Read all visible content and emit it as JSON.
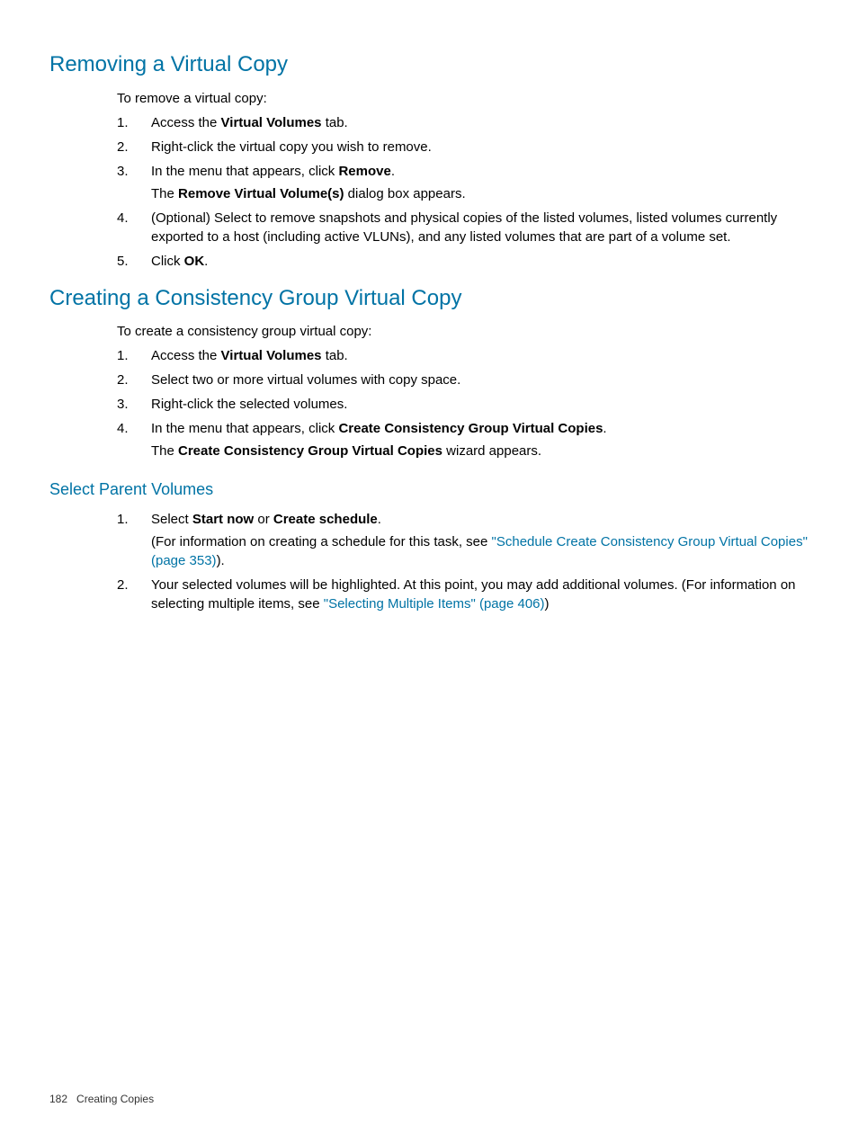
{
  "section1": {
    "title": "Removing a Virtual Copy",
    "intro": "To remove a virtual copy:",
    "items": {
      "i1_pre": "Access the ",
      "i1_bold": "Virtual Volumes",
      "i1_post": " tab.",
      "i2": "Right-click the virtual copy you wish to remove.",
      "i3_pre": "In the menu that appears, click ",
      "i3_bold": "Remove",
      "i3_post": ".",
      "i3_sub_pre": "The ",
      "i3_sub_bold": "Remove Virtual Volume(s)",
      "i3_sub_post": " dialog box appears.",
      "i4": "(Optional) Select to remove snapshots and physical copies of the listed volumes, listed volumes currently exported to a host (including active VLUNs), and any listed volumes that are part of a volume set.",
      "i5_pre": "Click ",
      "i5_bold": "OK",
      "i5_post": "."
    }
  },
  "section2": {
    "title": "Creating a Consistency Group Virtual Copy",
    "intro": "To create a consistency group virtual copy:",
    "items": {
      "i1_pre": "Access the ",
      "i1_bold": "Virtual Volumes",
      "i1_post": " tab.",
      "i2": "Select two or more virtual volumes with copy space.",
      "i3": "Right-click the selected volumes.",
      "i4_pre": "In the menu that appears, click ",
      "i4_bold": "Create Consistency Group Virtual Copies",
      "i4_post": ".",
      "i4_sub_pre": "The ",
      "i4_sub_bold": "Create Consistency Group Virtual Copies",
      "i4_sub_post": " wizard appears."
    }
  },
  "section3": {
    "title": "Select Parent Volumes",
    "items": {
      "i1_pre": "Select ",
      "i1_bold1": "Start now",
      "i1_mid": " or ",
      "i1_bold2": "Create schedule",
      "i1_post": ".",
      "i1_sub_pre": "(For information on creating a schedule for this task, see ",
      "i1_link": "\"Schedule Create Consistency Group Virtual Copies\" (page 353)",
      "i1_sub_post": ").",
      "i2_pre": "Your selected volumes will be highlighted. At this point, you may add additional volumes. (For information on selecting multiple items, see ",
      "i2_link": "\"Selecting Multiple Items\" (page 406)",
      "i2_post": ")"
    }
  },
  "footer": {
    "page": "182",
    "chapter": "Creating Copies"
  }
}
